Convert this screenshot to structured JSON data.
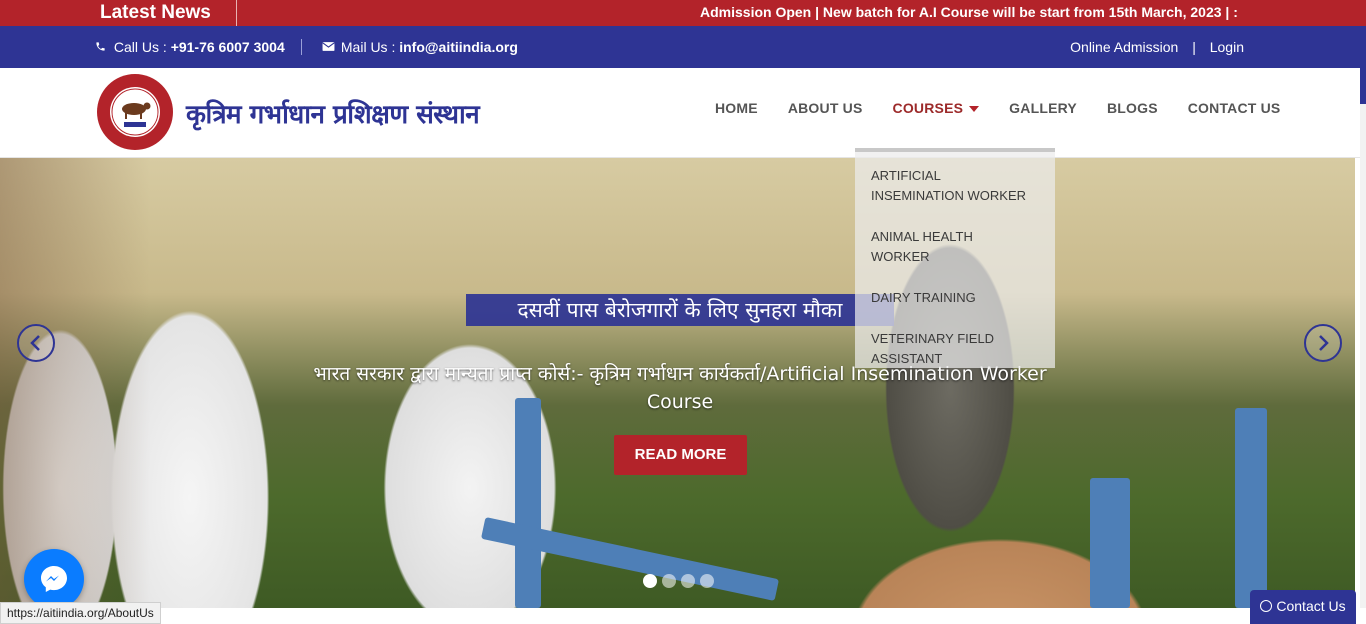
{
  "news": {
    "label": "Latest News",
    "ticker": "Admission Open | New batch for A.I Course will be start from 15th March, 2023 | :"
  },
  "topbar": {
    "call_label": "Call Us :",
    "call_number": "+91-76 6007 3004",
    "mail_label": "Mail Us :",
    "mail_address": "info@aitiindia.org",
    "online_admission": "Online Admission",
    "separator": "|",
    "login": "Login"
  },
  "header": {
    "brand": "कृत्रिम गर्भाधान प्रशिक्षण संस्थान",
    "logo_text_top": "BHARTI ARTIFICIAL INSEMINATION TRAINING INSTITUTE",
    "logo_text_bottom": "HISAR",
    "nav": [
      {
        "label": "HOME"
      },
      {
        "label": "ABOUT US"
      },
      {
        "label": "COURSES"
      },
      {
        "label": "GALLERY"
      },
      {
        "label": "BLOGS"
      },
      {
        "label": "CONTACT US"
      }
    ]
  },
  "dropdown": {
    "items": [
      {
        "line1": "ARTIFICIAL",
        "line2": "INSEMINATION WORKER"
      },
      {
        "line1": "ANIMAL HEALTH",
        "line2": "WORKER"
      },
      {
        "line1": "DAIRY TRAINING",
        "line2": ""
      },
      {
        "line1": "VETERINARY FIELD",
        "line2": "ASSISTANT"
      }
    ]
  },
  "hero": {
    "headline": "दसवीं पास बेरोजगारों के लिए सुनहरा मौका",
    "subtext_line1": "भारत सरकार द्वारा मान्यता प्राप्त कोर्स:- कृत्रिम गर्भाधान कार्यकर्ता/Artificial Insemination Worker",
    "subtext_line2": "Course",
    "button": "READ MORE",
    "slides": 4,
    "active_slide": 1
  },
  "footer": {
    "status_url": "https://aitiindia.org/AboutUs",
    "contact_us": "Contact Us"
  },
  "colors": {
    "news_red": "#b3232a",
    "brand_blue": "#2e3494",
    "nav_active": "#9c2a2a"
  }
}
